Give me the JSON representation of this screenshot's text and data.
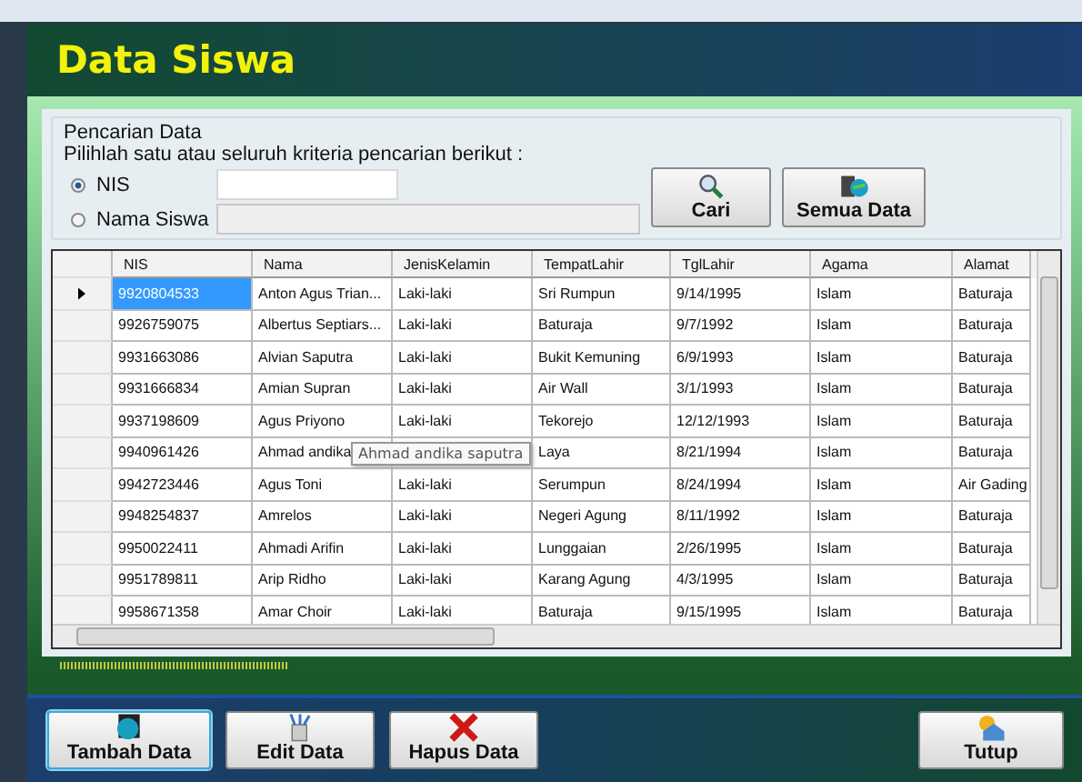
{
  "window": {
    "title": "Data Siswa"
  },
  "search": {
    "group_title": "Pencarian Data",
    "instruction": "Pilihlah satu atau seluruh kriteria pencarian berikut :",
    "options": [
      {
        "label": "NIS",
        "selected": true,
        "field_disabled": false
      },
      {
        "label": "Nama Siswa",
        "selected": false,
        "field_disabled": true
      }
    ],
    "buttons": [
      {
        "label": "Cari"
      },
      {
        "label": "Semua Data"
      }
    ]
  },
  "table": {
    "columns": [
      "NIS",
      "Nama",
      "JenisKelamin",
      "TempatLahir",
      "TglLahir",
      "Agama",
      "Alamat"
    ],
    "rows": [
      {
        "current": true,
        "cells": [
          "9920804533",
          "Anton Agus Trian...",
          "Laki-laki",
          "Sri Rumpun",
          "9/14/1995",
          "Islam",
          "Baturaja"
        ]
      },
      {
        "current": false,
        "cells": [
          "9926759075",
          "Albertus Septiars...",
          "Laki-laki",
          "Baturaja",
          "9/7/1992",
          "Islam",
          "Baturaja"
        ]
      },
      {
        "current": false,
        "cells": [
          "9931663086",
          "Alvian Saputra",
          "Laki-laki",
          "Bukit Kemuning",
          "6/9/1993",
          "Islam",
          "Baturaja"
        ]
      },
      {
        "current": false,
        "cells": [
          "9931666834",
          "Amian Supran",
          "Laki-laki",
          "Air Wall",
          "3/1/1993",
          "Islam",
          "Baturaja"
        ]
      },
      {
        "current": false,
        "cells": [
          "9937198609",
          "Agus Priyono",
          "Laki-laki",
          "Tekorejo",
          "12/12/1993",
          "Islam",
          "Baturaja"
        ]
      },
      {
        "current": false,
        "cells": [
          "9940961426",
          "Ahmad andika",
          null,
          "Laya",
          "8/21/1994",
          "Islam",
          "Baturaja"
        ],
        "tooltip": "Ahmad andika saputra"
      },
      {
        "current": false,
        "cells": [
          "9942723446",
          "Agus Toni",
          "Laki-laki",
          "Serumpun",
          "8/24/1994",
          "Islam",
          "Air Gading"
        ]
      },
      {
        "current": false,
        "cells": [
          "9948254837",
          "Amrelos",
          "Laki-laki",
          "Negeri Agung",
          "8/11/1992",
          "Islam",
          "Baturaja"
        ]
      },
      {
        "current": false,
        "cells": [
          "9950022411",
          "Ahmadi Arifin",
          "Laki-laki",
          "Lunggaian",
          "2/26/1995",
          "Islam",
          "Baturaja"
        ]
      },
      {
        "current": false,
        "cells": [
          "9951789811",
          "Arip Ridho",
          "Laki-laki",
          "Karang Agung",
          "4/3/1995",
          "Islam",
          "Baturaja"
        ]
      },
      {
        "current": false,
        "cells": [
          "9958671358",
          "Amar Choir",
          "Laki-laki",
          "Baturaja",
          "9/15/1995",
          "Islam",
          "Baturaja"
        ]
      }
    ]
  },
  "actions": [
    {
      "label": "Tambah Data",
      "focused": true
    },
    {
      "label": "Edit Data",
      "focused": false
    },
    {
      "label": "Hapus Data",
      "focused": false
    },
    {
      "label": "Tutup",
      "focused": false
    }
  ]
}
